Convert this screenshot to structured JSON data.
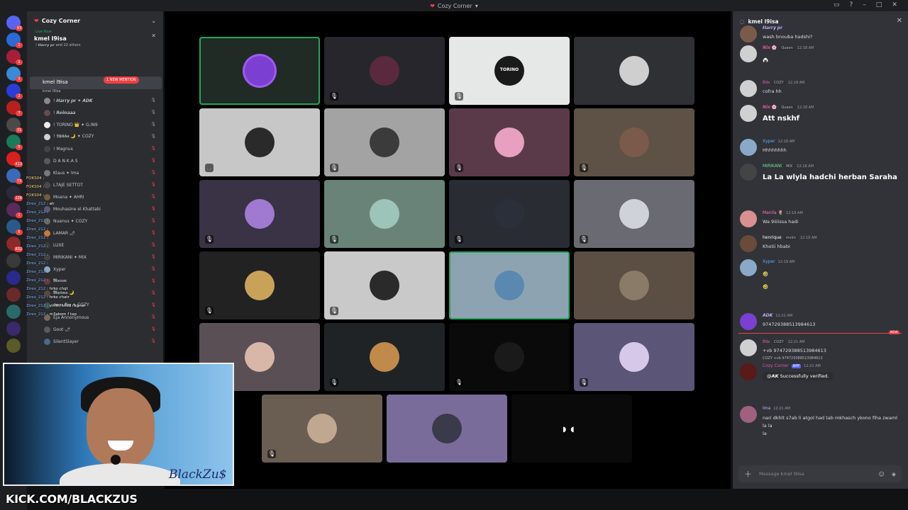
{
  "window": {
    "title": "Cozy Corner"
  },
  "server": {
    "name": "Cozy Corner"
  },
  "rail_badges": [
    "93",
    "1",
    "1",
    "3",
    "2",
    "7",
    "31",
    "5",
    "413",
    "73",
    "126",
    "1",
    "5",
    "832"
  ],
  "live": {
    "label": "Live Now",
    "channel": "kmel l9isa",
    "members_summary": "! 𝙃𝙖𝙧𝙧𝙮 𝙥𝙧 and 22 others"
  },
  "voice_channel": {
    "name": "kmel l9isa",
    "sub": "kmel l9isa",
    "mention_badge": "1 NEW MENTION",
    "members": [
      "! 𝙃𝙖𝙧𝙧𝙮 𝙥𝙧 ✦ 𝘼𝘿𝙆",
      "! 𝙍𝙚𝙞𝙣𝙖𝙖𝙖",
      "! TORINO 👑 ✦ G.IN9",
      "! 𝕯𝖍𝖎𝖐𝖐𝖆 🌙 ✦ COZY",
      "! Magnus",
      "D A N K A S",
      "Klaus ✦ lma",
      "L7AJE SETTOT",
      "Moana ✦ AHRI",
      "Mouhasine el Khattabi",
      "Nuanus ✦ COZY",
      "LAMAR 🌶",
      "LUXE",
      "MIRIKANI ✦ MIX",
      "Xyper",
      "𝕸𝖆𝖗𝖈𝖆𝖓",
      "𝕸𝖆𝖗𝖎𝖒𝖆 🌙",
      "𝕺𝖒𝖆𝖗 𝕭𝖊𝖌 ✦ COZY",
      "Eja Annonymous",
      "Goot 🌶",
      "SilentSlayer"
    ]
  },
  "overlay_chat": [
    {
      "user": "FOKS04",
      "text": ""
    },
    {
      "user": "FOKS04",
      "text": ""
    },
    {
      "user": "FOKS04",
      "text": ""
    },
    {
      "user": "Zirex_212",
      "text": "ah"
    },
    {
      "user": "Zirex_212",
      "text": ""
    },
    {
      "user": "Zirex_212",
      "text": ""
    },
    {
      "user": "Zirex_212",
      "text": ""
    },
    {
      "user": "Zirex_212",
      "text": ""
    },
    {
      "user": "Zirex_212",
      "text": ""
    },
    {
      "user": "Zirex_212",
      "text": ""
    },
    {
      "user": "Zirex_212",
      "text": ""
    },
    {
      "user": "Zirex_212",
      "text": ""
    },
    {
      "user": "Zirex_212",
      "text": ""
    },
    {
      "user": "Zirex_212",
      "text": "hrko chqt"
    },
    {
      "user": "Zirex_212",
      "text": "hrko chatr"
    },
    {
      "user": "Zirex_212",
      "text": "virfini smiti ragnar"
    },
    {
      "user": "Zirex_212",
      "text": "m3akom f tap"
    }
  ],
  "stage": {
    "tiles": [
      {
        "bg": "#1f2b24",
        "av": "#7b3fd1",
        "speaking": true,
        "icon": ""
      },
      {
        "bg": "#26262c",
        "av": "#5a2a3c",
        "speaking": false,
        "icon": "🎙"
      },
      {
        "bg": "#e6e8e8",
        "av": "#1a1a1a",
        "speaking": false,
        "icon": "🎙",
        "label": "TORINO"
      },
      {
        "bg": "#2f3033",
        "av": "#cfcfcf",
        "speaking": false,
        "icon": ""
      },
      {
        "bg": "#c7c7c7",
        "av": "#2a2a2a",
        "speaking": false,
        "icon": "🎧"
      },
      {
        "bg": "#a3a3a3",
        "av": "#3b3b3b",
        "speaking": false,
        "icon": "🎙"
      },
      {
        "bg": "#5a3a48",
        "av": "#e8a0c0",
        "speaking": false,
        "icon": "🎙"
      },
      {
        "bg": "#5e5146",
        "av": "#7a5a4a",
        "speaking": false,
        "icon": "🎙"
      },
      {
        "bg": "#3a3245",
        "av": "#a07ad0",
        "speaking": false,
        "icon": "🎙"
      },
      {
        "bg": "#6a8378",
        "av": "#9cc4b8",
        "speaking": false,
        "icon": "🎙"
      },
      {
        "bg": "#292c33",
        "av": "#2a2f3a",
        "speaking": false,
        "icon": "🎙"
      },
      {
        "bg": "#6a6a72",
        "av": "#cfd2d8",
        "speaking": false,
        "icon": "🎙"
      },
      {
        "bg": "#222222",
        "av": "#c9a25a",
        "speaking": false,
        "icon": "🎙"
      },
      {
        "bg": "#c9c9c9",
        "av": "#2a2a2a",
        "speaking": false,
        "icon": "🎙"
      },
      {
        "bg": "#8ea3b2",
        "av": "#5a88b0",
        "speaking": true,
        "icon": ""
      },
      {
        "bg": "#5b4e43",
        "av": "#8a7a68",
        "speaking": false,
        "icon": ""
      },
      {
        "bg": "#5a4f55",
        "av": "#d9b7a8",
        "speaking": false,
        "icon": ""
      },
      {
        "bg": "#1f2325",
        "av": "#c08a4a",
        "speaking": false,
        "icon": "🎙"
      },
      {
        "bg": "#0a0a0a",
        "av": "#1a1a1a",
        "speaking": false,
        "icon": "🎙"
      },
      {
        "bg": "#5b5578",
        "av": "#d6c8e8",
        "speaking": false,
        "icon": "🎙"
      },
      {
        "bg": "#6a5d52",
        "av": "#c0a890",
        "speaking": false,
        "icon": "🎙"
      },
      {
        "bg": "#7a6c9a",
        "av": "#3a3a4a",
        "speaking": false,
        "icon": ""
      },
      {
        "bg": "#0a0a0a",
        "av": "#0a0a0a",
        "speaking": false,
        "icon": ""
      }
    ]
  },
  "chat": {
    "header": "kmel l9isa",
    "messages": [
      {
        "user": "𝙃𝙖𝙧𝙧𝙮 𝙥𝙧",
        "user_color": "#c8b4ff",
        "tag": "",
        "time": "",
        "body": "wash bnouba hadshi?",
        "big": false,
        "av": "#7a5a4a"
      },
      {
        "user": "𝙉𝙞𝙭 🌸",
        "user_color": "#e058a8",
        "tag": "Queen",
        "time": "12:18 AM",
        "body": "🍙",
        "big": false,
        "av": "#d0d0d0"
      },
      {
        "user": "𝕷𝖎𝖑𝖆",
        "user_color": "#e058a8",
        "tag": "COZY",
        "time": "12:18 AM",
        "body": "cofra hh",
        "big": false,
        "av": "#d0d0d0"
      },
      {
        "user": "𝙉𝙞𝙭 🌸",
        "user_color": "#e058a8",
        "tag": "Queen",
        "time": "12:18 AM",
        "body": "Att nskhf",
        "big": true,
        "av": "#d0d0d0"
      },
      {
        "user": "Xyper",
        "user_color": "#5db0ff",
        "tag": "",
        "time": "12:18 AM",
        "body": "Hhhhhhhh",
        "big": false,
        "av": "#8aa8c8"
      },
      {
        "user": "MIRIKANI",
        "user_color": "#7ae0a0",
        "tag": "MIX",
        "time": "12:18 AM",
        "body": "La La wlyla hadchi herban Saraha",
        "big": true,
        "av": "#444"
      },
      {
        "user": "Manila 🌷",
        "user_color": "#ff7ab8",
        "tag": "",
        "time": "12:19 AM",
        "body": "Wa 9iiiissa hadi",
        "big": false,
        "av": "#d89090"
      },
      {
        "user": "henrique",
        "user_color": "#ffffff",
        "tag": "mvim",
        "time": "12:19 AM",
        "body": "Khotii hbabi",
        "big": false,
        "av": "#6a4a3a"
      },
      {
        "user": "Xyper",
        "user_color": "#5db0ff",
        "tag": "",
        "time": "12:19 AM",
        "body": "🤣\n🤣",
        "big": false,
        "av": "#8aa8c8"
      },
      {
        "user": "𝘼𝘿𝙆",
        "user_color": "#c8b4ff",
        "tag": "",
        "time": "12:21 AM",
        "body": "974729388513984613",
        "big": false,
        "av": "#7b3fd1"
      },
      {
        "user": "𝕷𝖎𝖑𝖆",
        "user_color": "#e058a8",
        "tag": "COZY",
        "time": "12:21 AM",
        "body": "+vb 974729388513984613",
        "big": false,
        "av": "#d0d0d0"
      },
      {
        "user": "Cozy Corner",
        "user_color": "#e058a8",
        "tag": "APP",
        "time": "12:21 AM",
        "body": "@𝘼𝙆 Successfully verified.",
        "big": false,
        "av": "#5a1a1a",
        "reply": "COZY +vb 974729388513984613"
      },
      {
        "user": "lma",
        "user_color": "#c8b4ff",
        "tag": "",
        "time": "12:21 AM",
        "body": "nari dkhlt s7ab li atgol had tab mkhasch ykono fiha zwaml\nla la\nla",
        "big": false,
        "av": "#a06080"
      }
    ],
    "new_label": "NEW",
    "composer_placeholder": "Message kmel l9isa"
  },
  "webcam": {
    "signature": "BlackZu$"
  },
  "watermark": "KICK.COM/BLACKZUS"
}
